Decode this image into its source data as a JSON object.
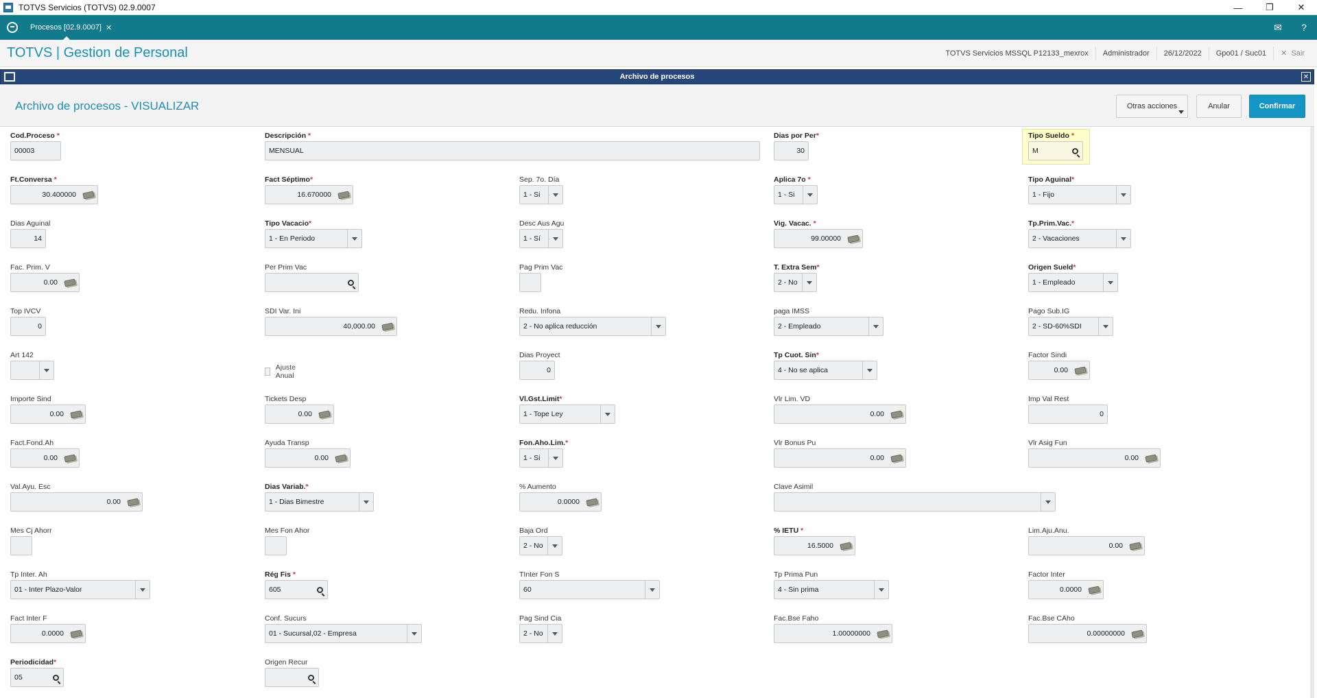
{
  "window": {
    "title": "TOTVS Servicios (TOTVS) 02.9.0007"
  },
  "tabs": [
    {
      "label": "Procesos [02.9.0007]"
    }
  ],
  "app_header": {
    "brand": "TOTVS | Gestion de Personal",
    "server": "TOTVS Servicios MSSQL P12133_mexrox",
    "user": "Administrador",
    "date": "26/12/2022",
    "branch": "Gpo01 / Suc01",
    "exit": "Sair"
  },
  "dialog": {
    "title": "Archivo de procesos",
    "heading": "Archivo de procesos - VISUALIZAR",
    "buttons": {
      "more": "Otras acciones",
      "cancel": "Anular",
      "confirm": "Confirmar"
    }
  },
  "fields": {
    "cod_proceso": {
      "label": "Cod.Proceso",
      "value": "00003"
    },
    "descripcion": {
      "label": "Descripción",
      "value": "MENSUAL"
    },
    "dias_por_per": {
      "label": "Dias por Per",
      "value": "30"
    },
    "tipo_sueldo": {
      "label": "Tipo Sueldo",
      "value": "M"
    },
    "ft_conversa": {
      "label": "Ft.Conversa",
      "value": "30.400000"
    },
    "fact_septimo": {
      "label": "Fact Séptimo",
      "value": "16.670000"
    },
    "sep_7o_dia": {
      "label": "Sep. 7o. Día",
      "value": "1 - Si"
    },
    "aplica_7o": {
      "label": "Aplica 7o",
      "value": "1 - Si"
    },
    "tipo_aguinal": {
      "label": "Tipo Aguinal",
      "value": "1 - Fijo"
    },
    "dias_aguinal": {
      "label": "Dias Aguinal",
      "value": "14"
    },
    "tipo_vacacio": {
      "label": "Tipo Vacacio",
      "value": "1 - En Periodo"
    },
    "desc_aus_agu": {
      "label": "Desc Aus Agu",
      "value": "1 - Sí"
    },
    "vig_vacac": {
      "label": "Vig. Vacac.",
      "value": "99.00000"
    },
    "tp_prim_vac": {
      "label": "Tp.Prim.Vac.",
      "value": "2 - Vacaciones"
    },
    "fac_prim_v": {
      "label": "Fac. Prim. V",
      "value": "0.00"
    },
    "per_prim_vac": {
      "label": "Per Prim Vac",
      "value": ""
    },
    "pag_prim_vac": {
      "label": "Pag Prim Vac",
      "value": ""
    },
    "t_extra_sem": {
      "label": "T. Extra Sem",
      "value": "2 - No"
    },
    "origen_sueld": {
      "label": "Origen Sueld",
      "value": "1 - Empleado"
    },
    "top_ivcv": {
      "label": "Top IVCV",
      "value": "0"
    },
    "sdi_var_ini": {
      "label": "SDI Var. Ini",
      "value": "40,000.00"
    },
    "redu_infona": {
      "label": "Redu. Infona",
      "value": "2 - No aplica reducción"
    },
    "paga_imss": {
      "label": "paga IMSS",
      "value": "2 - Empleado"
    },
    "pago_sub_ig": {
      "label": "Pago Sub.IG",
      "value": "2 - SD-60%SDI"
    },
    "art_142": {
      "label": "Art 142",
      "value": ""
    },
    "ajuste_anual": {
      "label": "Ajuste Anual"
    },
    "dias_proyect": {
      "label": "Dias Proyect",
      "value": "0"
    },
    "tp_cuot_sin": {
      "label": "Tp Cuot. Sin",
      "value": "4 - No se aplica"
    },
    "factor_sindi": {
      "label": "Factor Sindi",
      "value": "0.00"
    },
    "importe_sind": {
      "label": "Importe Sind",
      "value": "0.00"
    },
    "tickets_desp": {
      "label": "Tickets Desp",
      "value": "0.00"
    },
    "vl_gst_limit": {
      "label": "Vl.Gst.Limit",
      "value": "1 -  Tope Ley"
    },
    "vlr_lim_vd": {
      "label": "Vlr Lim. VD",
      "value": "0.00"
    },
    "imp_val_rest": {
      "label": "Imp Val Rest",
      "value": "0"
    },
    "fact_fond_ah": {
      "label": "Fact.Fond.Ah",
      "value": "0.00"
    },
    "ayuda_transp": {
      "label": "Ayuda Transp",
      "value": "0.00"
    },
    "fon_aho_lim": {
      "label": "Fon.Aho.Lim.",
      "value": "1 - Si"
    },
    "vlr_bonus_pu": {
      "label": "Vlr Bonus Pu",
      "value": "0.00"
    },
    "vlr_asig_fun": {
      "label": "Vlr Asig Fun",
      "value": "0.00"
    },
    "val_ayu_esc": {
      "label": "Val.Ayu. Esc",
      "value": "0.00"
    },
    "dias_variab": {
      "label": "Dias Variab.",
      "value": "1 - Dias Bimestre"
    },
    "pct_aumento": {
      "label": "% Aumento",
      "value": "0.0000"
    },
    "clave_asimil": {
      "label": "Clave Asimil",
      "value": ""
    },
    "mes_cj_ahorr": {
      "label": "Mes Cj Ahorr",
      "value": ""
    },
    "mes_fon_ahor": {
      "label": "Mes Fon Ahor",
      "value": ""
    },
    "baja_ord": {
      "label": "Baja Ord",
      "value": "2 - No"
    },
    "pct_ietu": {
      "label": "% IETU",
      "value": "16.5000"
    },
    "lim_aju_anu": {
      "label": "Lim.Aju.Anu.",
      "value": "0.00"
    },
    "tp_inter_ah": {
      "label": "Tp Inter. Ah",
      "value": "01 - Inter Plazo-Valor"
    },
    "reg_fis": {
      "label": "Rég Fis",
      "value": "605"
    },
    "tinter_fon_s": {
      "label": "TInter Fon S",
      "value": "60"
    },
    "tp_prima_pun": {
      "label": "Tp Prima Pun",
      "value": "4 - Sin prima"
    },
    "factor_inter": {
      "label": "Factor Inter",
      "value": "0.0000"
    },
    "fact_inter_f": {
      "label": "Fact Inter F",
      "value": "0.0000"
    },
    "conf_sucurs": {
      "label": "Conf. Sucurs",
      "value": "01 - Sucursal,02 - Empresa"
    },
    "pag_sind_cia": {
      "label": "Pag Sind Cia",
      "value": "2 - No"
    },
    "fac_bse_faho": {
      "label": "Fac.Bse Faho",
      "value": "1.00000000"
    },
    "fac_bse_caho": {
      "label": "Fac.Bse CAho",
      "value": "0.00000000"
    },
    "periodicidad": {
      "label": "Periodicidad",
      "value": "05"
    },
    "origen_recur": {
      "label": "Origen Recur",
      "value": ""
    }
  },
  "colors": {
    "tabbar": "#117a8b",
    "brand": "#1a8fb5",
    "dialog_bar": "#27467a",
    "required": "#e03030",
    "primary_button": "#1594c6"
  }
}
